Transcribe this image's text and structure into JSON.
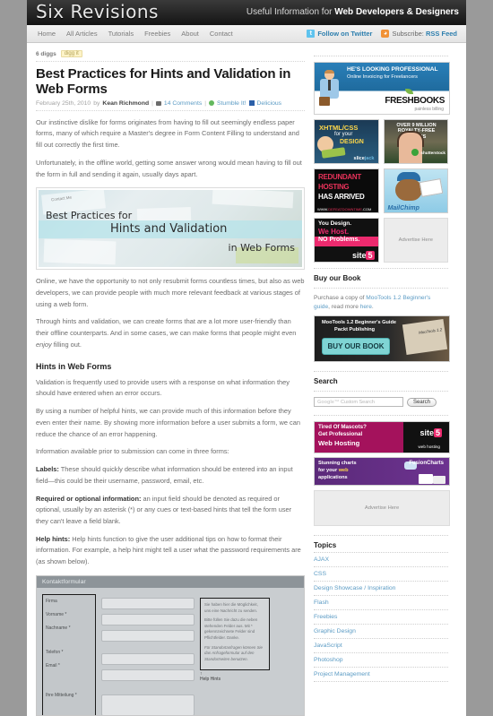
{
  "site": {
    "logo": "Six Revisions",
    "tagline_prefix": "Useful Information for ",
    "tagline_bold": "Web Developers & Designers"
  },
  "nav": {
    "items": [
      "Home",
      "All Articles",
      "Tutorials",
      "Freebies",
      "About",
      "Contact"
    ],
    "twitter_label": "Follow on Twitter",
    "twitter_icon": "twitter-icon",
    "rss_prefix": "Subscribe: ",
    "rss_label": "RSS Feed",
    "rss_icon": "rss-icon"
  },
  "article": {
    "digg_count": "6 diggs",
    "digg_button": "digg it",
    "title": "Best Practices for Hints and Validation in Web Forms",
    "date": "February 25th, 2010",
    "by_word": "by",
    "author": "Kean Richmond",
    "comments": "14 Comments",
    "stumble": "Stumble It!",
    "delicious": "Delicious",
    "paragraphs": [
      "Our instinctive dislike for forms originates from having to fill out seemingly endless paper forms, many of which require a Master's degree in Form Content Filling to understand and fill out correctly the first time.",
      "Unfortunately, in the offline world, getting some answer wrong would mean having to fill out the form in full and sending it again, usually days apart."
    ],
    "featured_image": {
      "line1": "Best Practices for",
      "line2": "Hints and Validation",
      "line3": "in Web Forms",
      "contact_note": "Contact Me"
    },
    "paragraphs2": [
      "Online, we have the opportunity to not only resubmit forms countless times, but also as web developers, we can provide people with much more relevant feedback at various stages of using a web form.",
      "Through hints and validation, we can create forms that are a lot more user-friendly than their offline counterparts. And in some cases, we can make forms that people might even enjoy filling out."
    ],
    "section_heading": "Hints in Web Forms",
    "paragraphs3": [
      "Validation is frequently used to provide users with a response on what information they should have entered when an error occurs.",
      "By using a number of helpful hints, we can provide much of this information before they even enter their name. By showing more information before a user submits a form, we can reduce the chance of an error happening.",
      "Information available prior to submission can come in three forms:"
    ],
    "bullets": [
      {
        "term": "Labels:",
        "text": " These should quickly describe what information should be entered into an input field—this could be their username, password, email, etc."
      },
      {
        "term": "Required or optional information:",
        "text": " an input field should be denoted as required or optional, usually by an asterisk (*) or any cues or text-based hints that tell the form user they can't leave a field blank."
      },
      {
        "term": "Help hints:",
        "text": " Help hints function to give the user additional tips on how to format their information. For example, a help hint might tell a user what the password requirements are (as shown below)."
      }
    ],
    "form_screenshot": {
      "header": "Kontaktformular",
      "labels": [
        "Firma",
        "Vorname *",
        "Nachname *",
        "Telefon *",
        "Email *",
        "Ihre Mitteilung *"
      ],
      "hint_paragraphs": [
        "Sie haben hier die Möglichkeit, uns eine Nachricht zu senden.",
        "Bitte füllen Sie dazu die neben stehenden Felder aus. Mit * gekennzeichnete Felder sind Pflichtfelder. Danke."
      ],
      "hint_italic": "Für Standortanfragen können Sie das Anfrageformular auf den Standortseiten benutzen.",
      "annotation": "Help Hints"
    }
  },
  "sidebar": {
    "ads": {
      "freshbooks": {
        "headline": "HE'S LOOKING PROFESSIONAL",
        "subline": "Online Invoicing for Freelancers",
        "brand_a": "FRESH",
        "brand_b": "BOOKS",
        "brand_sub": "painless billing"
      },
      "slicejack": {
        "line1": "XHTML/CSS",
        "line2": "for your",
        "line3": "DESIGN",
        "brand_a": "slice",
        "brand_b": "jack"
      },
      "shutterstock": {
        "headline": "OVER 9 MILLION ROYALTY-FREE IMAGES",
        "brand": "shutterstock"
      },
      "redundant": {
        "line1": "REDUNDANT",
        "line2": "HOSTING",
        "line3": "HAS ARRIVED",
        "url_a": "WWW.",
        "url_b": "DEFEATDOWNTIME",
        "url_c": ".COM"
      },
      "mailchimp": {
        "brand": "MailChimp"
      },
      "site5": {
        "line1": "You Design.",
        "line2": "We Host.",
        "line3": "NO Problems.",
        "brand": "site",
        "brand_num": "5"
      },
      "advertise_here": "Advertise Here",
      "site5_hosting": {
        "line1": "Tired Of Mascots?",
        "line2": "Get Professional",
        "line3": "Web Hosting",
        "brand": "site",
        "brand_num": "5",
        "brand_sub": "web hosting"
      },
      "fusioncharts": {
        "line1": "Stunning charts",
        "line2a": "for your ",
        "line2b": "web",
        "line3": "applications",
        "brand": "FusionCharts"
      }
    },
    "book": {
      "title": "Buy our Book",
      "text_a": "Purchase a copy of ",
      "link_a": "MooTools 1.2 Beginner's guide",
      "text_b": ", read more ",
      "link_b": "here",
      "text_c": ".",
      "banner_line1": "MooTools 1.2 Beginner's Guide",
      "banner_line2": "Packt Publishing",
      "banner_button": "BUY OUR BOOK",
      "banner_cover": "MooTools 1.2"
    },
    "search": {
      "title": "Search",
      "google_mark": "Google™",
      "placeholder": "Custom Search",
      "value": "",
      "button": "Search"
    },
    "topics": {
      "title": "Topics",
      "items": [
        "AJAX",
        "CSS",
        "Design Showcase / Inspiration",
        "Flash",
        "Freebies",
        "Graphic Design",
        "JavaScript",
        "Photoshop",
        "Project Management"
      ]
    }
  },
  "colors": {
    "link": "#5b9bc4",
    "accent_orange": "#f19237",
    "twitter_blue": "#5fc3ee",
    "page_bg": "#9a9a9a"
  }
}
